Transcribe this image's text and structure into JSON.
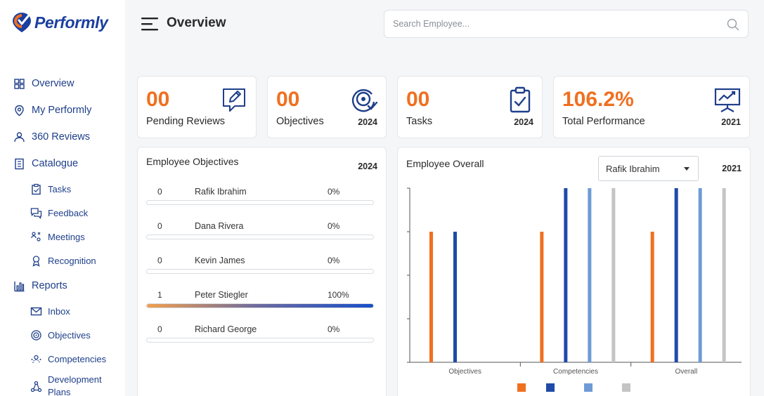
{
  "app": {
    "name": "Performly"
  },
  "header": {
    "title": "Overview",
    "search_placeholder": "Search Employee..."
  },
  "sidebar": {
    "items": [
      {
        "label": "Overview",
        "icon": "grid-icon",
        "sub": false
      },
      {
        "label": "My Performly",
        "icon": "location-pin-icon",
        "sub": false
      },
      {
        "label": "360 Reviews",
        "icon": "users-icon",
        "sub": false
      },
      {
        "label": "Catalogue",
        "icon": "catalogue-icon",
        "sub": false
      },
      {
        "label": "Tasks",
        "icon": "clipboard-icon",
        "sub": true
      },
      {
        "label": "Feedback",
        "icon": "chat-icon",
        "sub": true
      },
      {
        "label": "Meetings",
        "icon": "meeting-icon",
        "sub": true
      },
      {
        "label": "Recognition",
        "icon": "award-icon",
        "sub": true
      },
      {
        "label": "Reports",
        "icon": "bar-chart-icon",
        "sub": false
      },
      {
        "label": "Inbox",
        "icon": "mail-icon",
        "sub": true
      },
      {
        "label": "Objectives",
        "icon": "target-icon",
        "sub": true
      },
      {
        "label": "Competencies",
        "icon": "competency-icon",
        "sub": true
      },
      {
        "label": "Development Plans",
        "icon": "network-icon",
        "sub": true
      }
    ]
  },
  "kpis": [
    {
      "value": "00",
      "label": "Pending Reviews",
      "year": "",
      "icon": "edit-review-icon"
    },
    {
      "value": "00",
      "label": "Objectives",
      "year": "2024",
      "icon": "target-check-icon"
    },
    {
      "value": "00",
      "label": "Tasks",
      "year": "2024",
      "icon": "clipboard-check-icon"
    },
    {
      "value": "106.2%",
      "label": "Total Performance",
      "year": "2021",
      "icon": "presentation-chart-icon"
    }
  ],
  "objectives": {
    "title": "Employee Objectives",
    "year": "2024",
    "rows": [
      {
        "count": "0",
        "name": "Rafik Ibrahim",
        "percent": "0%",
        "progress": 0
      },
      {
        "count": "0",
        "name": "Dana Rivera",
        "percent": "0%",
        "progress": 0
      },
      {
        "count": "0",
        "name": "Kevin James",
        "percent": "0%",
        "progress": 0
      },
      {
        "count": "1",
        "name": "Peter Stiegler",
        "percent": "100%",
        "progress": 1
      },
      {
        "count": "0",
        "name": "Richard George",
        "percent": "0%",
        "progress": 0
      }
    ]
  },
  "overall": {
    "title": "Employee Overall",
    "year": "2021",
    "selected_employee": "Rafik Ibrahim"
  },
  "chart_data": {
    "type": "bar",
    "categories": [
      "Objectives",
      "Competencies",
      "Overall"
    ],
    "series": [
      {
        "values": [
          3,
          3,
          3
        ],
        "color": "#f07020"
      },
      {
        "values": [
          3,
          4,
          4
        ],
        "color": "#1f4aa8"
      },
      {
        "values": [
          null,
          4,
          4
        ],
        "color": "#6e9bd6"
      },
      {
        "values": [
          null,
          4,
          4
        ],
        "color": "#c4c4c4"
      }
    ],
    "ylim": [
      0,
      4
    ],
    "grid": false,
    "legend_position": "bottom"
  }
}
